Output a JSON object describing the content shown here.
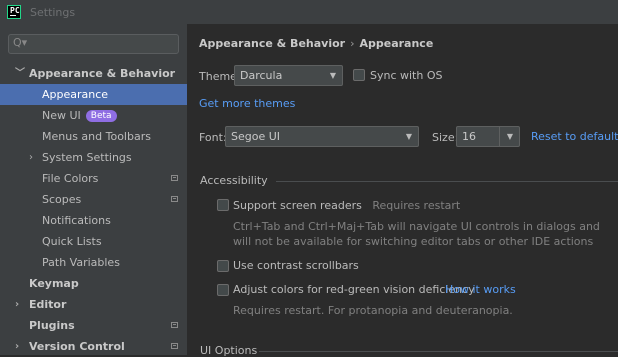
{
  "window": {
    "title": "Settings",
    "logo_text": "PC"
  },
  "search": {
    "icon": "Q▾",
    "placeholder": ""
  },
  "sidebar": {
    "items": [
      {
        "label": "Appearance & Behavior",
        "expanded": true
      },
      {
        "label": "Appearance"
      },
      {
        "label": "New UI",
        "badge": "Beta"
      },
      {
        "label": "Menus and Toolbars"
      },
      {
        "label": "System Settings"
      },
      {
        "label": "File Colors"
      },
      {
        "label": "Scopes"
      },
      {
        "label": "Notifications"
      },
      {
        "label": "Quick Lists"
      },
      {
        "label": "Path Variables"
      },
      {
        "label": "Keymap"
      },
      {
        "label": "Editor"
      },
      {
        "label": "Plugins"
      },
      {
        "label": "Version Control"
      }
    ]
  },
  "breadcrumb": {
    "parent": "Appearance & Behavior",
    "separator": "›",
    "current": "Appearance"
  },
  "theme": {
    "label": "Theme:",
    "value": "Darcula",
    "sync_label": "Sync with OS",
    "more_themes": "Get more themes"
  },
  "font": {
    "label": "Font:",
    "value": "Segoe UI",
    "size_label": "Size:",
    "size_value": "16",
    "reset": "Reset to default"
  },
  "accessibility": {
    "title": "Accessibility",
    "screen_readers": "Support screen readers",
    "screen_readers_hint": "Requires restart",
    "screen_readers_desc_1": "Ctrl+Tab and Ctrl+Maj+Tab will navigate UI controls in dialogs and",
    "screen_readers_desc_2": "will not be available for switching editor tabs or other IDE actions",
    "contrast_scrollbars": "Use contrast scrollbars",
    "color_deficiency": "Adjust colors for red-green vision deficiency",
    "how_it_works": "How it works",
    "color_deficiency_desc": "Requires restart. For protanopia and deuteranopia."
  },
  "ui_options": {
    "title": "UI Options"
  },
  "colors": {
    "accent": "#4b6eaf",
    "link": "#589df6",
    "badge": "#8f6ee3"
  }
}
